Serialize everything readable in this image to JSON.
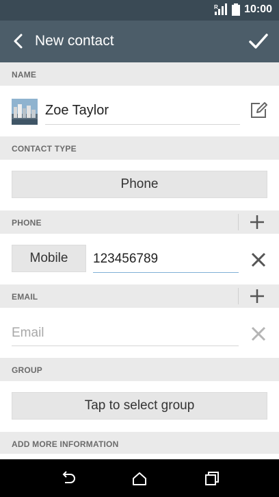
{
  "status_bar": {
    "time": "10:00",
    "icons": [
      "signal-icon",
      "battery-icon"
    ]
  },
  "app_bar": {
    "title": "New contact",
    "icons": [
      "back-arrow-icon",
      "checkmark-icon"
    ]
  },
  "sections": {
    "name": {
      "label": "NAME",
      "value": "Zoe Taylor",
      "icons": [
        "avatar-photo",
        "edit-icon"
      ]
    },
    "contact_type": {
      "label": "CONTACT TYPE",
      "button_label": "Phone"
    },
    "phone": {
      "label": "PHONE",
      "type_label": "Mobile",
      "value": "123456789",
      "icons": [
        "plus-icon",
        "clear-icon"
      ]
    },
    "email": {
      "label": "EMAIL",
      "placeholder": "Email",
      "icons": [
        "plus-icon",
        "clear-icon"
      ]
    },
    "group": {
      "label": "GROUP",
      "button_label": "Tap to select group"
    },
    "more_info": {
      "label": "ADD MORE INFORMATION"
    }
  },
  "nav_bar": {
    "icons": [
      "back-nav-icon",
      "home-icon",
      "recents-icon"
    ]
  },
  "colors": {
    "app_bar": "#4c5d69",
    "status_bar": "#3a4a55",
    "section_bg": "#eaeaea",
    "focus_underline": "#7fb0d6"
  }
}
